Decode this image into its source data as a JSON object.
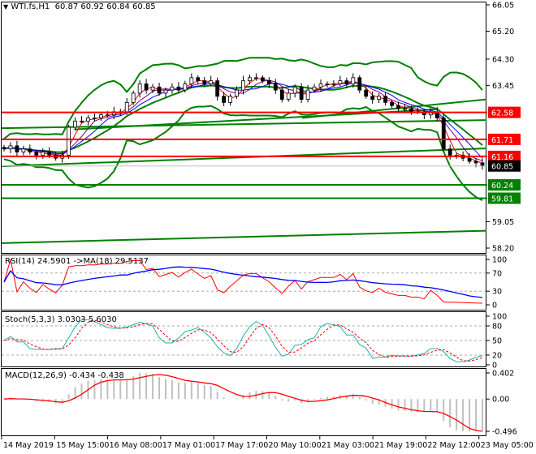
{
  "header": {
    "symbol": "WTI.fs,H1",
    "ohlc": "60.87 60.92 60.84 60.85"
  },
  "indicators": {
    "rsi": "RSI(14) 24.5901  ->MA(18) 29.5137",
    "stoch": "Stoch(5,3,3) 3.0303 5.6030",
    "macd": "MACD(12,26,9) -0.434 -0.438"
  },
  "colors": {
    "up": "#000000",
    "down": "#000000",
    "level_red": "#ff0000",
    "level_green": "#008000",
    "bands": "#008000",
    "ma_fast": "#ff0000",
    "ma_slow": "#0000ff",
    "ma_mid": "#800080",
    "rsi": "#ff0000",
    "rsi_ma": "#0000ff",
    "stoch_main": "#20b2aa",
    "stoch_signal": "#ff0000",
    "macd_hist": "#c0c0c0",
    "macd_signal": "#ff0000"
  },
  "chart_data": {
    "type": "candlestick",
    "title": "WTI.fs,H1",
    "ylim": [
      58.2,
      66.05
    ],
    "price_ticks": [
      "66.05",
      "65.20",
      "64.30",
      "63.45",
      "59.05",
      "58.20"
    ],
    "close": [
      61.4,
      61.5,
      61.3,
      61.4,
      61.3,
      61.2,
      61.3,
      61.2,
      61.1,
      61.2,
      62.1,
      62.3,
      62.3,
      62.4,
      62.4,
      62.5,
      62.5,
      62.6,
      62.6,
      62.9,
      63.2,
      63.5,
      63.3,
      63.4,
      63.2,
      63.3,
      63.4,
      63.3,
      63.5,
      63.7,
      63.6,
      63.5,
      63.6,
      63.1,
      62.9,
      63.1,
      63.3,
      63.6,
      63.7,
      63.7,
      63.6,
      63.5,
      63.3,
      63.0,
      63.2,
      63.4,
      63.0,
      63.3,
      63.4,
      63.5,
      63.5,
      63.5,
      63.6,
      63.5,
      63.7,
      63.3,
      63.1,
      63.0,
      63.1,
      62.9,
      62.8,
      62.7,
      62.7,
      62.6,
      62.6,
      62.5,
      62.6,
      62.4,
      61.4,
      61.2,
      61.2,
      61.1,
      61.0,
      60.95,
      60.85
    ],
    "levels": [
      {
        "price": 62.58,
        "label": "62.58",
        "color": "#ff0000"
      },
      {
        "price": 61.71,
        "label": "61.71",
        "color": "#ff0000"
      },
      {
        "price": 61.16,
        "label": "61.16",
        "color": "#ff0000"
      },
      {
        "price": 60.24,
        "label": "60.24",
        "color": "#008000"
      },
      {
        "price": 59.81,
        "label": "59.81",
        "color": "#008000"
      }
    ],
    "current": {
      "price": 60.85,
      "label": "60.85"
    },
    "trendlines": [
      {
        "from": [
          0,
          60.84
        ],
        "to": [
          1,
          61.42
        ]
      },
      {
        "from": [
          0,
          58.36
        ],
        "to": [
          1,
          58.76
        ]
      },
      {
        "from": [
          0,
          62.07
        ],
        "to": [
          1,
          62.33
        ]
      },
      {
        "from": [
          0.15,
          62.03
        ],
        "to": [
          0.9,
          62.68
        ]
      },
      {
        "from": [
          0.62,
          62.4
        ],
        "to": [
          1,
          63.0
        ]
      }
    ],
    "rsi": {
      "ticks": [
        "100",
        "70",
        "30",
        "0"
      ],
      "levels": [
        70,
        30
      ]
    },
    "stoch": {
      "ticks": [
        "100",
        "80",
        "50",
        "20",
        "0"
      ],
      "levels": [
        80,
        50,
        20
      ]
    },
    "macd": {
      "ticks": [
        "0.402",
        "0.00",
        "-0.496"
      ],
      "ylim": [
        -0.496,
        0.402
      ]
    },
    "x_labels": [
      "14 May 2019",
      "15 May 15:00",
      "16 May 08:00",
      "17 May 01:00",
      "17 May 17:00",
      "20 May 10:00",
      "21 May 03:00",
      "21 May 19:00",
      "22 May 12:00",
      "23 May 05:00"
    ]
  }
}
